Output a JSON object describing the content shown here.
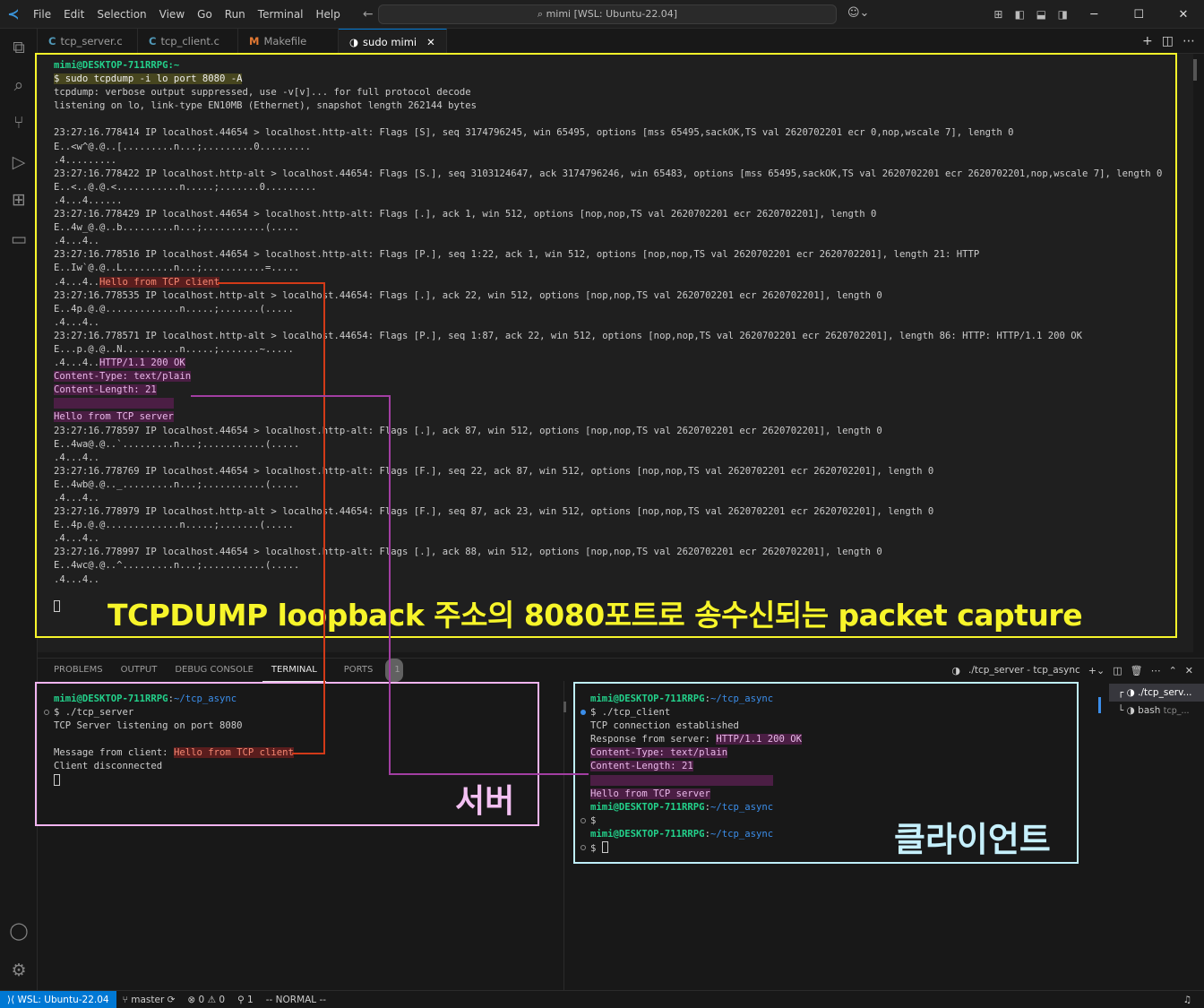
{
  "titlebar": {
    "menu": [
      "File",
      "Edit",
      "Selection",
      "View",
      "Go",
      "Run",
      "Terminal",
      "Help"
    ],
    "command_center": "mimi [WSL: Ubuntu-22.04]"
  },
  "tabs": [
    {
      "icon": "C",
      "label": "tcp_server.c"
    },
    {
      "icon": "C",
      "label": "tcp_client.c"
    },
    {
      "icon": "M",
      "label": "Makefile"
    },
    {
      "icon": "",
      "label": "sudo  mimi"
    }
  ],
  "tcpdump": {
    "prompt": "mimi@DESKTOP-711RRPG:~",
    "command": "$ sudo tcpdump -i lo port 8080 -A",
    "lines": [
      "tcpdump: verbose output suppressed, use -v[v]... for full protocol decode",
      "listening on lo, link-type EN10MB (Ethernet), snapshot length 262144 bytes",
      "",
      "23:27:16.778414 IP localhost.44654 > localhost.http-alt: Flags [S], seq 3174796245, win 65495, options [mss 65495,sackOK,TS val 2620702201 ecr 0,nop,wscale 7], length 0",
      "E..<w^@.@..[.........n...;.........0.........",
      ".4.........",
      "23:27:16.778422 IP localhost.http-alt > localhost.44654: Flags [S.], seq 3103124647, ack 3174796246, win 65483, options [mss 65495,sackOK,TS val 2620702201 ecr 2620702201,nop,wscale 7], length 0",
      "E..<..@.@.<...........n.....;.......0.........",
      ".4...4......",
      "23:27:16.778429 IP localhost.44654 > localhost.http-alt: Flags [.], ack 1, win 512, options [nop,nop,TS val 2620702201 ecr 2620702201], length 0",
      "E..4w_@.@..b.........n...;...........(.....",
      ".4...4..",
      "23:27:16.778516 IP localhost.44654 > localhost.http-alt: Flags [P.], seq 1:22, ack 1, win 512, options [nop,nop,TS val 2620702201 ecr 2620702201], length 21: HTTP",
      "E..Iw`@.@..L.........n...;...........=.....",
      ".4...4..",
      "23:27:16.778535 IP localhost.http-alt > localhost.44654: Flags [.], ack 22, win 512, options [nop,nop,TS val 2620702201 ecr 2620702201], length 0",
      "E..4p.@.@.............n.....;.......(.....",
      ".4...4..",
      "23:27:16.778571 IP localhost.http-alt > localhost.44654: Flags [P.], seq 1:87, ack 22, win 512, options [nop,nop,TS val 2620702201 ecr 2620702201], length 86: HTTP: HTTP/1.1 200 OK",
      "E...p.@.@..N..........n.....;.......~.....",
      ".4...4..",
      "Content-Type: text/plain",
      "Content-Length: 21",
      "",
      "Hello from TCP server",
      "23:27:16.778597 IP localhost.44654 > localhost.http-alt: Flags [.], ack 87, win 512, options [nop,nop,TS val 2620702201 ecr 2620702201], length 0",
      "E..4wa@.@..`.........n...;...........(.....",
      ".4...4..",
      "23:27:16.778769 IP localhost.44654 > localhost.http-alt: Flags [F.], seq 22, ack 87, win 512, options [nop,nop,TS val 2620702201 ecr 2620702201], length 0",
      "E..4wb@.@.._.........n...;...........(.....",
      ".4...4..",
      "23:27:16.778979 IP localhost.http-alt > localhost.44654: Flags [F.], seq 87, ack 23, win 512, options [nop,nop,TS val 2620702201 ecr 2620702201], length 0",
      "E..4p.@.@.............n.....;.......(.....",
      ".4...4..",
      "23:27:16.778997 IP localhost.44654 > localhost.http-alt: Flags [.], ack 88, win 512, options [nop,nop,TS val 2620702201 ecr 2620702201], length 0",
      "E..4wc@.@..^.........n...;...........(.....",
      ".4...4.."
    ],
    "client_payload": "Hello from TCP client",
    "server_payload_first": "HTTP/1.1 200 OK"
  },
  "caption_main": "TCPDUMP loopback 주소의 8080포트로 송수신되는 packet capture",
  "panel": {
    "tabs": [
      "PROBLEMS",
      "OUTPUT",
      "DEBUG CONSOLE",
      "TERMINAL",
      "PORTS"
    ],
    "ports_count": "1",
    "active_terminal": "./tcp_server - tcp_async",
    "terminal_list": [
      {
        "label": "./tcp_serv...",
        "sub": ""
      },
      {
        "label": "bash",
        "sub": "tcp_..."
      }
    ]
  },
  "server_terminal": {
    "prompt": "mimi@DESKTOP-711RRPG:~/tcp_async",
    "lines": [
      "$ ./tcp_server",
      "TCP Server listening on port 8080",
      "",
      "Client disconnected"
    ],
    "message_label": "Message from client: ",
    "message_value": "Hello from TCP client"
  },
  "client_terminal": {
    "prompt": "mimi@DESKTOP-711RRPG:~/tcp_async",
    "cmd": "$ ./tcp_client",
    "established": "TCP connection established",
    "response_label": "Response from server: ",
    "response_lines": [
      "HTTP/1.1 200 OK",
      "Content-Type: text/plain",
      "Content-Length: 21",
      "",
      "Hello from TCP server"
    ],
    "dollar": "$",
    "dollar2": "$ "
  },
  "caption_server": "서버",
  "caption_client": "클라이언트",
  "statusbar": {
    "remote": "WSL: Ubuntu-22.04",
    "branch": "master",
    "problems": "⊗ 0 ⚠ 0",
    "ports": "1",
    "mode": "-- NORMAL --"
  },
  "colors": {
    "highlight_frame": "#f7f52a",
    "server_frame": "#f1b4f0",
    "client_frame": "#bfeefb",
    "connector_red": "#d23a18",
    "connector_purple": "#a23ea2"
  }
}
